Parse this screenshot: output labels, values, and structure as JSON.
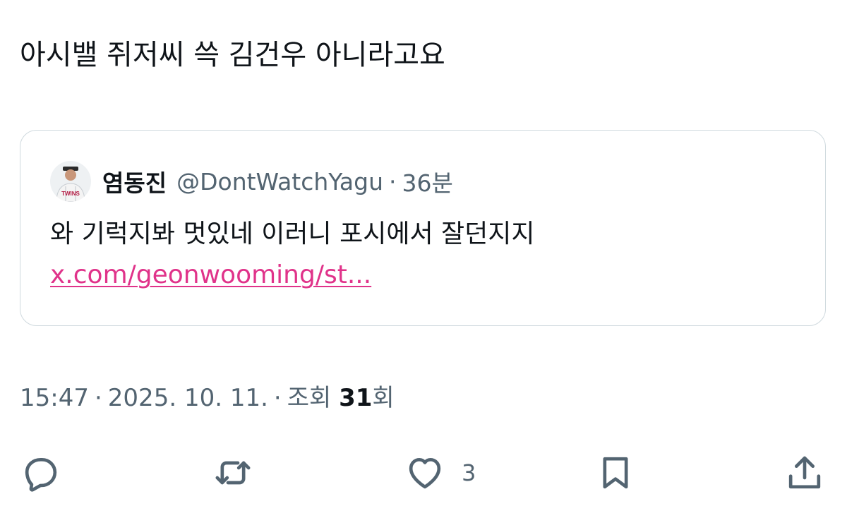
{
  "tweet": {
    "text": "아시밸 쥐저씨 쓱 김건우 아니라고요"
  },
  "quote": {
    "display_name": "염동진",
    "handle": "@DontWatchYagu",
    "separator": "·",
    "time": "36분",
    "text": "와 기럭지봐 멋있네 이러니 포시에서 잘던지지 ",
    "link": "x.com/geonwooming/st...",
    "avatar_jersey_text": "TWINS"
  },
  "meta": {
    "time": "15:47",
    "separator": "·",
    "date": "2025. 10. 11.",
    "views_label": "조회",
    "views_count": "31",
    "views_suffix": "회"
  },
  "actions": {
    "like_count": "3",
    "icons": [
      "reply-icon",
      "retweet-icon",
      "like-icon",
      "bookmark-icon",
      "share-icon"
    ]
  },
  "colors": {
    "text": "#0f1419",
    "secondary": "#536471",
    "link": "#e0338a",
    "border": "#cfd9de"
  }
}
